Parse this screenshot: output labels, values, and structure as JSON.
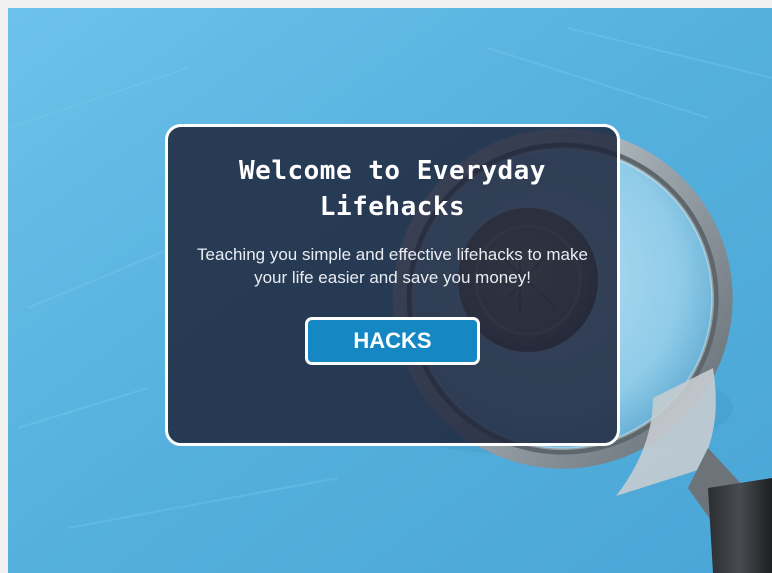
{
  "hero": {
    "title": "Welcome to Everyday Lifehacks",
    "subtitle": "Teaching you simple and effective lifehacks to make your life easier and save you money!",
    "button_label": "HACKS"
  },
  "background": {
    "image_subject": "magnifying-glass-over-coin",
    "base_color": "#5cb6e2"
  },
  "colors": {
    "card_overlay": "#1f273d",
    "card_border": "#ffffff",
    "button_fill": "#1588c3",
    "button_text": "#ffffff"
  }
}
